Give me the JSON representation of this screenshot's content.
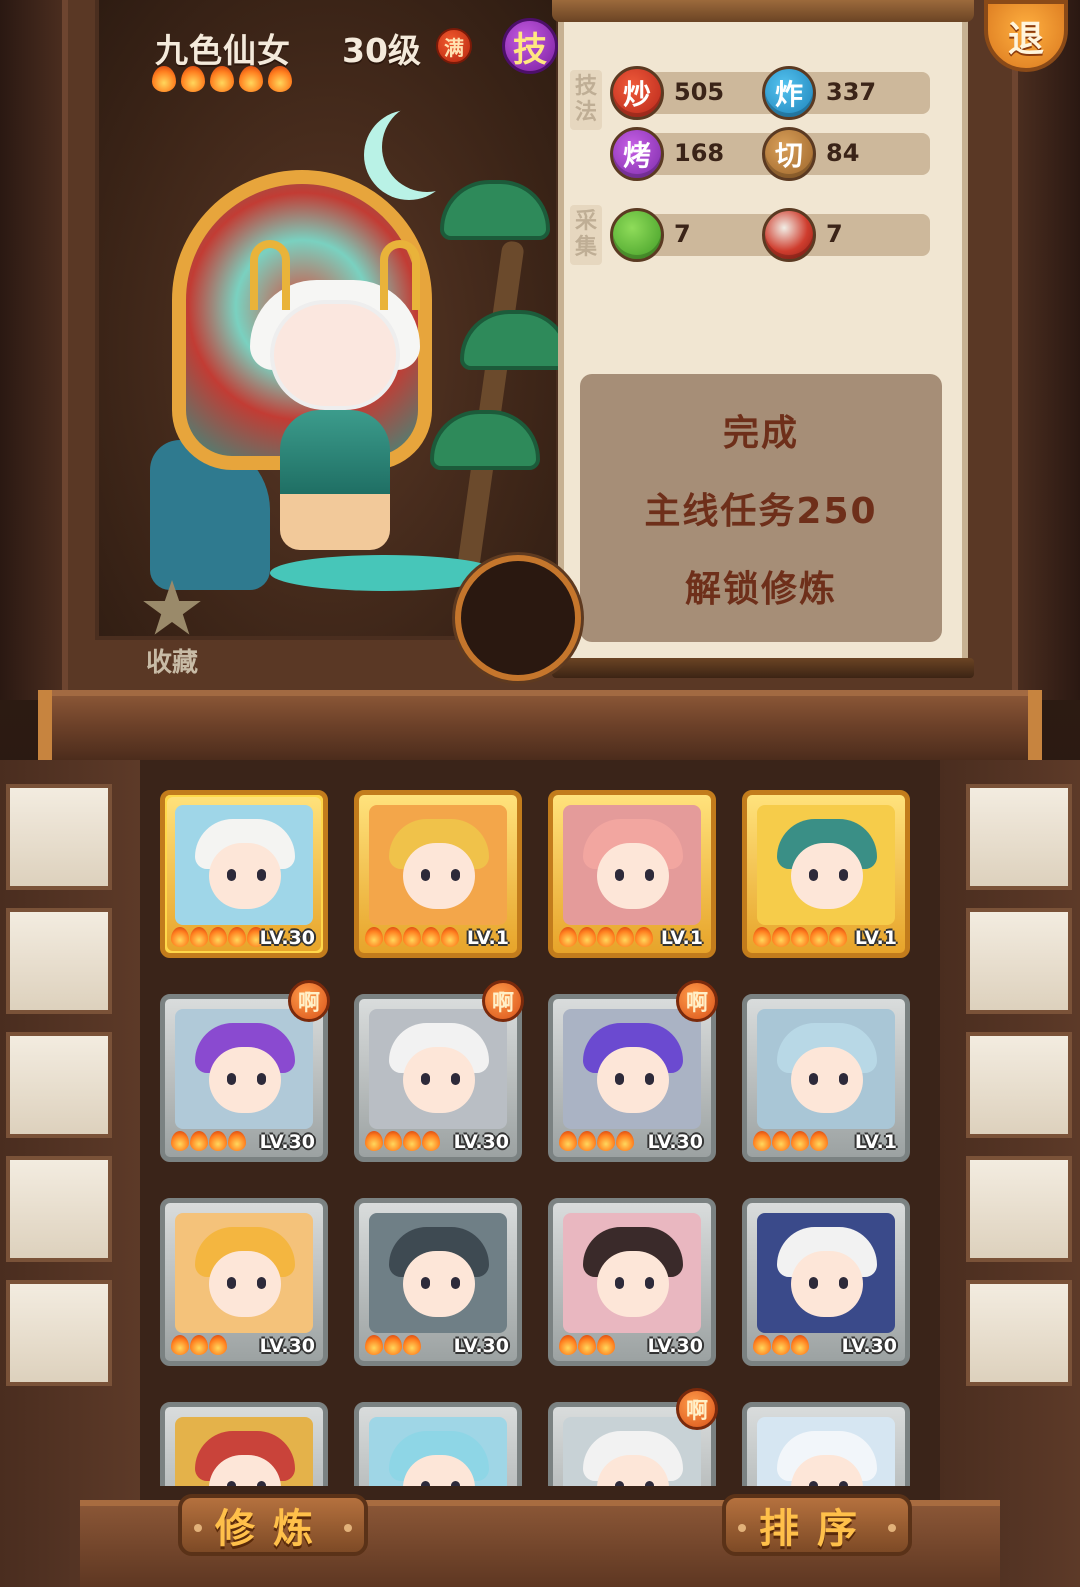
{
  "hero": {
    "name": "九色仙女",
    "level": "30级",
    "max_badge": "满",
    "skill_badge": "技",
    "stars": 5
  },
  "exit_button": "退",
  "favorite": {
    "label": "收藏"
  },
  "stats": {
    "technique_label": "技法",
    "gather_label": "采集",
    "technique": [
      {
        "icon": "炒",
        "value": "505",
        "color": "#c23a25"
      },
      {
        "icon": "炸",
        "value": "337",
        "color": "#2a8fc8"
      },
      {
        "icon": "烤",
        "value": "168",
        "color": "#8b36b5"
      },
      {
        "icon": "切",
        "value": "84",
        "color": "#a86e30"
      }
    ],
    "gather": [
      {
        "icon": "cabbage-icon",
        "value": "7"
      },
      {
        "icon": "meat-icon",
        "value": "7"
      }
    ]
  },
  "unlock": {
    "line1": "完成",
    "line2": "主线任务250",
    "line3": "解锁修炼"
  },
  "roster": [
    {
      "level": "LV.30",
      "stars": 5,
      "frame": "gold",
      "selected": true,
      "badge": ""
    },
    {
      "level": "LV.1",
      "stars": 5,
      "frame": "gold",
      "selected": false,
      "badge": ""
    },
    {
      "level": "LV.1",
      "stars": 5,
      "frame": "gold",
      "selected": false,
      "badge": ""
    },
    {
      "level": "LV.1",
      "stars": 5,
      "frame": "gold",
      "selected": false,
      "badge": ""
    },
    {
      "level": "LV.30",
      "stars": 4,
      "frame": "silver",
      "selected": false,
      "badge": "啊"
    },
    {
      "level": "LV.30",
      "stars": 4,
      "frame": "silver",
      "selected": false,
      "badge": "啊"
    },
    {
      "level": "LV.30",
      "stars": 4,
      "frame": "silver",
      "selected": false,
      "badge": "啊"
    },
    {
      "level": "LV.1",
      "stars": 4,
      "frame": "silver",
      "selected": false,
      "badge": ""
    },
    {
      "level": "LV.30",
      "stars": 3,
      "frame": "silver",
      "selected": false,
      "badge": ""
    },
    {
      "level": "LV.30",
      "stars": 3,
      "frame": "silver",
      "selected": false,
      "badge": ""
    },
    {
      "level": "LV.30",
      "stars": 3,
      "frame": "silver",
      "selected": false,
      "badge": ""
    },
    {
      "level": "LV.30",
      "stars": 3,
      "frame": "silver",
      "selected": false,
      "badge": ""
    },
    {
      "level": "",
      "stars": 0,
      "frame": "silver",
      "selected": false,
      "badge": ""
    },
    {
      "level": "",
      "stars": 0,
      "frame": "silver",
      "selected": false,
      "badge": ""
    },
    {
      "level": "",
      "stars": 0,
      "frame": "silver",
      "selected": false,
      "badge": "啊"
    },
    {
      "level": "",
      "stars": 0,
      "frame": "silver",
      "selected": false,
      "badge": ""
    }
  ],
  "buttons": {
    "cultivate": "修炼",
    "sort": "排序"
  }
}
